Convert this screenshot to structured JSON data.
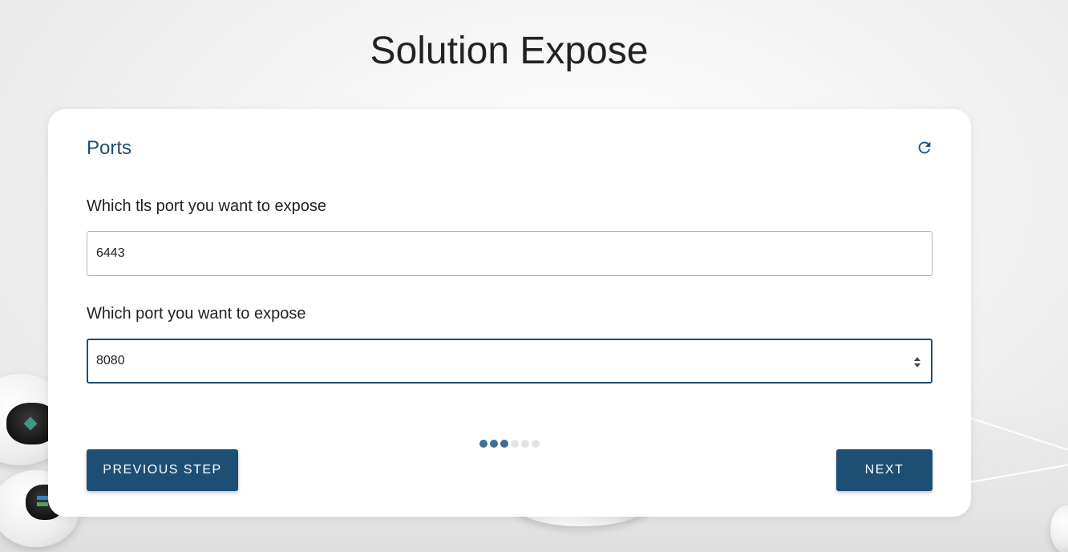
{
  "page": {
    "title": "Solution Expose"
  },
  "card": {
    "title": "Ports",
    "refresh_icon": "refresh-icon",
    "tls_port": {
      "label": "Which tls port you want to expose",
      "value": "6443"
    },
    "port": {
      "label": "Which port you want to expose",
      "value": "8080"
    },
    "progress": {
      "current_step": 3,
      "total_steps": 6
    },
    "previous_label": "PREVIOUS STEP",
    "next_label": "NEXT"
  },
  "colors": {
    "accent": "#1d4e74",
    "progress_done": "#3f6e93",
    "progress_todo": "#e3e3e3"
  }
}
